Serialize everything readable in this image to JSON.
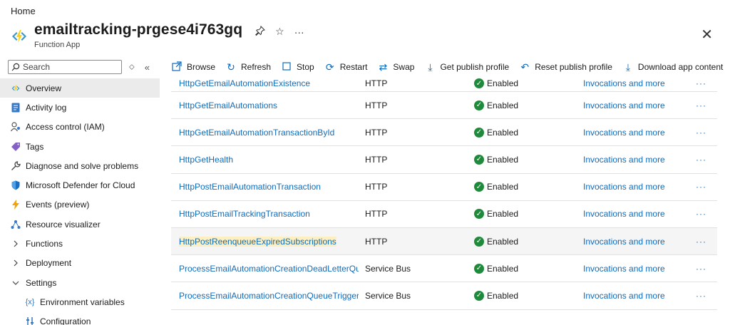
{
  "breadcrumb": "Home",
  "header": {
    "title": "emailtracking-prgese4i763gq",
    "subtitle": "Function App",
    "more": "···",
    "close": "✕"
  },
  "search": {
    "placeholder": "Search"
  },
  "sidebar": {
    "items": [
      {
        "label": "Overview",
        "icon": "function-app-icon"
      },
      {
        "label": "Activity log",
        "icon": "activity-log-icon"
      },
      {
        "label": "Access control (IAM)",
        "icon": "iam-icon"
      },
      {
        "label": "Tags",
        "icon": "tag-icon"
      },
      {
        "label": "Diagnose and solve problems",
        "icon": "wrench-icon"
      },
      {
        "label": "Microsoft Defender for Cloud",
        "icon": "shield-icon"
      },
      {
        "label": "Events (preview)",
        "icon": "lightning-icon"
      },
      {
        "label": "Resource visualizer",
        "icon": "visualizer-icon"
      },
      {
        "label": "Functions",
        "icon": "chevron-right-icon"
      },
      {
        "label": "Deployment",
        "icon": "chevron-right-icon"
      },
      {
        "label": "Settings",
        "icon": "chevron-down-icon"
      },
      {
        "label": "Environment variables",
        "icon": "variables-icon"
      },
      {
        "label": "Configuration",
        "icon": "configuration-icon"
      }
    ]
  },
  "toolbar": {
    "browse": "Browse",
    "refresh": "Refresh",
    "stop": "Stop",
    "restart": "Restart",
    "swap": "Swap",
    "get_publish_profile": "Get publish profile",
    "reset_publish_profile": "Reset publish profile",
    "download_app_content": "Download app content",
    "more": "···"
  },
  "functions": {
    "rows": [
      {
        "name": "HttpGetEmailAutomationExistence",
        "type": "HTTP",
        "status": "Enabled",
        "link": "Invocations and more",
        "more": "···"
      },
      {
        "name": "HttpGetEmailAutomations",
        "type": "HTTP",
        "status": "Enabled",
        "link": "Invocations and more",
        "more": "···"
      },
      {
        "name": "HttpGetEmailAutomationTransactionById",
        "type": "HTTP",
        "status": "Enabled",
        "link": "Invocations and more",
        "more": "···"
      },
      {
        "name": "HttpGetHealth",
        "type": "HTTP",
        "status": "Enabled",
        "link": "Invocations and more",
        "more": "···"
      },
      {
        "name": "HttpPostEmailAutomationTransaction",
        "type": "HTTP",
        "status": "Enabled",
        "link": "Invocations and more",
        "more": "···"
      },
      {
        "name": "HttpPostEmailTrackingTransaction",
        "type": "HTTP",
        "status": "Enabled",
        "link": "Invocations and more",
        "more": "···"
      },
      {
        "name": "HttpPostReenqueueExpiredSubscriptions",
        "type": "HTTP",
        "status": "Enabled",
        "link": "Invocations and more",
        "more": "···"
      },
      {
        "name": "ProcessEmailAutomationCreationDeadLetterQueueTrigger",
        "type": "Service Bus",
        "status": "Enabled",
        "link": "Invocations and more",
        "more": "···"
      },
      {
        "name": "ProcessEmailAutomationCreationQueueTrigger",
        "type": "Service Bus",
        "status": "Enabled",
        "link": "Invocations and more",
        "more": "···"
      }
    ]
  },
  "colors": {
    "accent": "#0f6cbd",
    "enabled_green": "#1f8a3b",
    "highlight": "#fdefc0"
  }
}
